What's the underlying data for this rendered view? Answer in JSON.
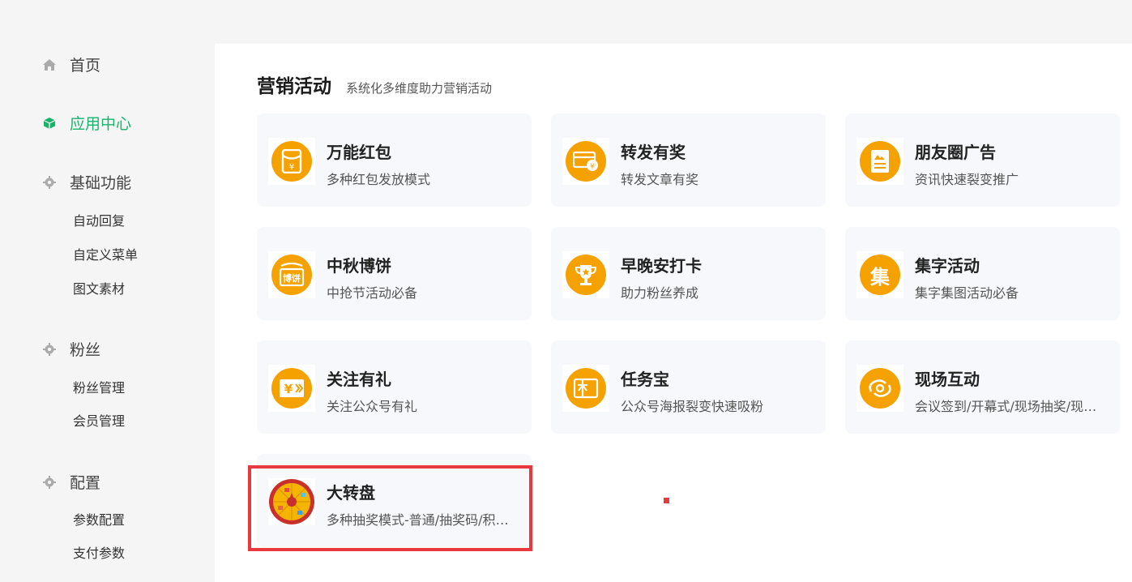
{
  "sidebar": {
    "home": "首页",
    "app_center": "应用中心",
    "basic": {
      "title": "基础功能",
      "items": [
        "自动回复",
        "自定义菜单",
        "图文素材"
      ]
    },
    "fans": {
      "title": "粉丝",
      "items": [
        "粉丝管理",
        "会员管理"
      ]
    },
    "config": {
      "title": "配置",
      "items": [
        "参数配置",
        "支付参数"
      ]
    }
  },
  "section": {
    "title": "营销活动",
    "subtitle": "系统化多维度助力营销活动"
  },
  "cards": [
    {
      "name": "万能红包",
      "desc": "多种红包发放模式",
      "icon": "red-packet-icon"
    },
    {
      "name": "转发有奖",
      "desc": "转发文章有奖",
      "icon": "share-reward-icon"
    },
    {
      "name": "朋友圈广告",
      "desc": "资讯快速裂变推广",
      "icon": "moments-ad-icon"
    },
    {
      "name": "中秋博饼",
      "desc": "中抢节活动必备",
      "icon": "bobing-icon",
      "icon_text": "博饼"
    },
    {
      "name": "早晚安打卡",
      "desc": "助力粉丝养成",
      "icon": "trophy-icon"
    },
    {
      "name": "集字活动",
      "desc": "集字集图活动必备",
      "icon": "collect-word-icon",
      "icon_text": "集"
    },
    {
      "name": "关注有礼",
      "desc": "关注公众号有礼",
      "icon": "follow-gift-icon"
    },
    {
      "name": "任务宝",
      "desc": "公众号海报裂变快速吸粉",
      "icon": "gift-box-icon"
    },
    {
      "name": "现场互动",
      "desc": "会议签到/开幕式/现场抽奖/现场互动",
      "icon": "live-interaction-icon"
    },
    {
      "name": "大转盘",
      "desc": "多种抽奖模式-普通/抽奖码/积分抽奖",
      "icon": "lucky-wheel-icon"
    }
  ],
  "colors": {
    "accent_green": "#1bb26b",
    "icon_orange": "#f5a200",
    "highlight_red": "#e8393f"
  }
}
